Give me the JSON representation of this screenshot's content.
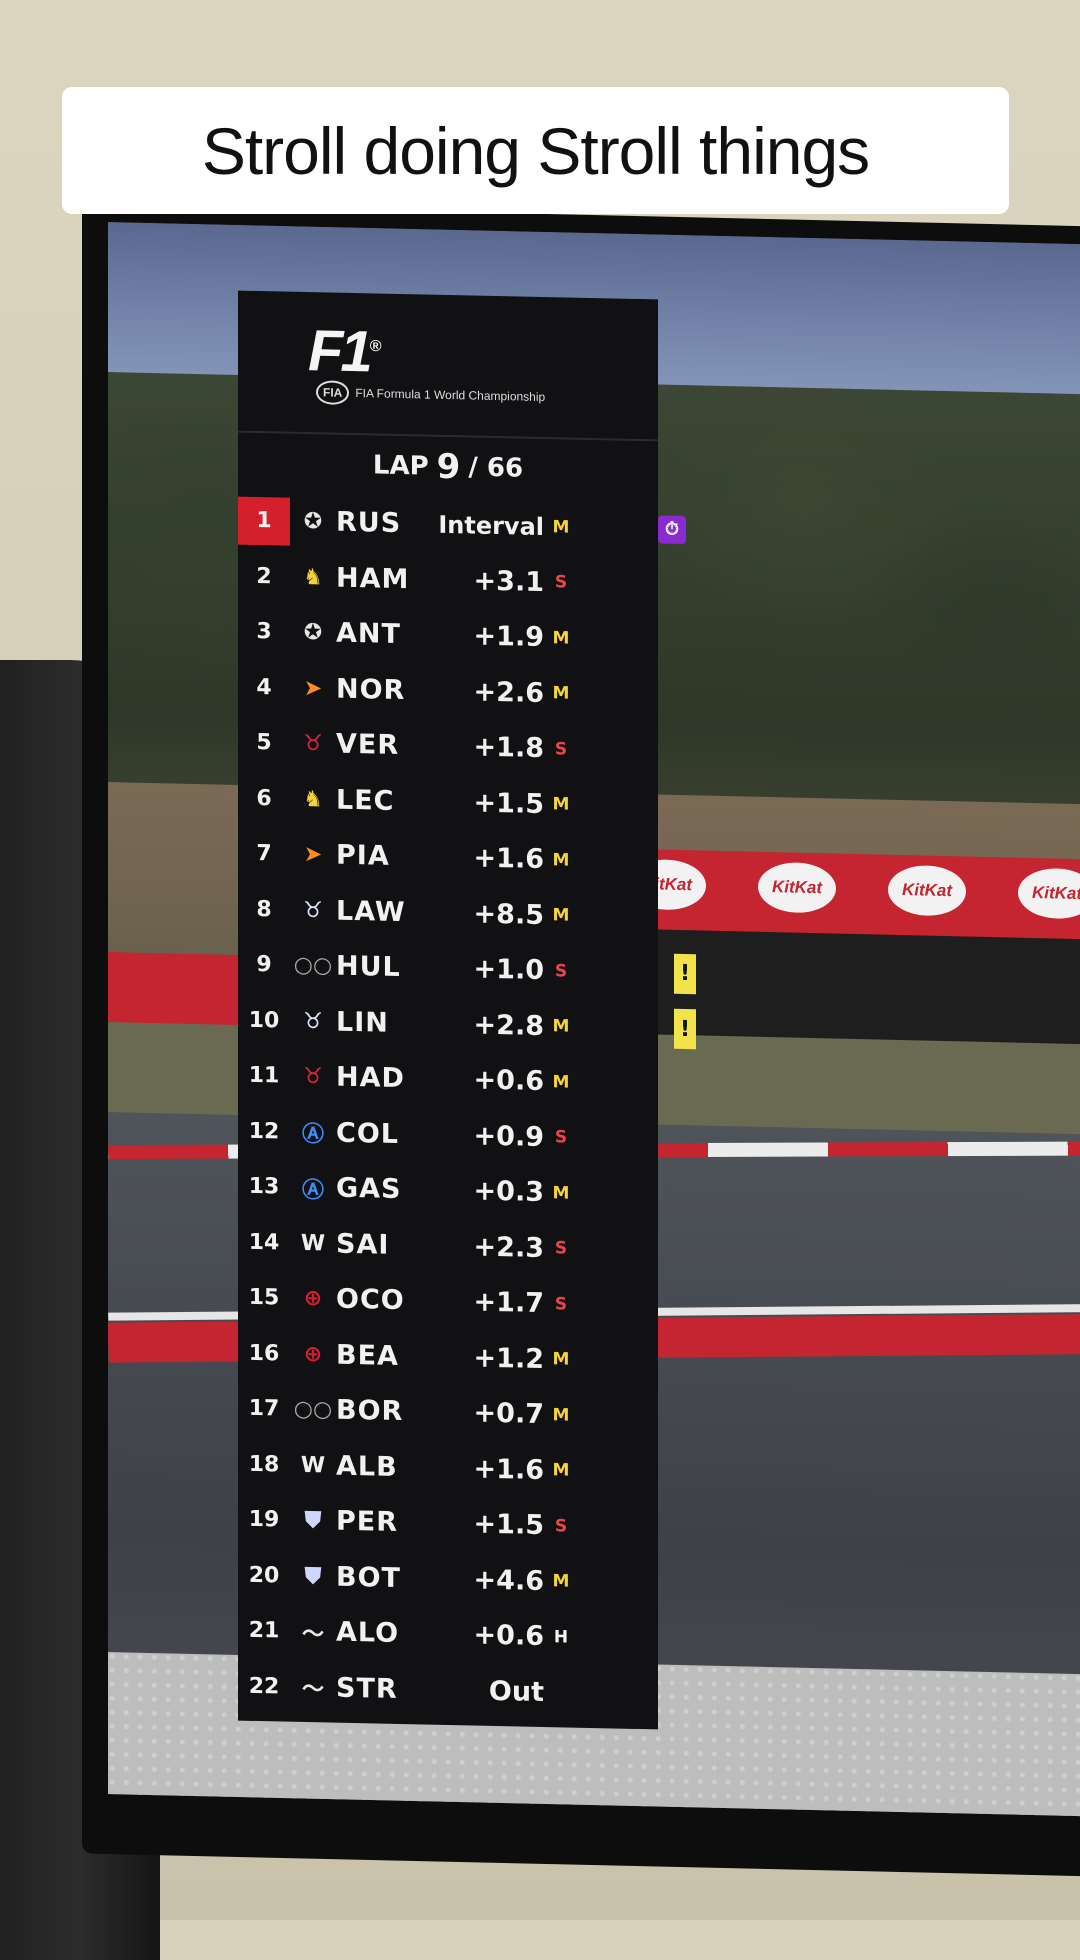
{
  "caption": "Stroll doing Stroll things",
  "broadcast": {
    "brand": "F1",
    "fia_text": "FIA Formula 1 World Championship",
    "lap_label": "LAP",
    "lap_current": "9",
    "lap_total": "/ 66",
    "sponsor": "KitKat"
  },
  "standings": [
    {
      "pos": "1",
      "team_icon": "mercedes-star",
      "code": "RUS",
      "gap": "Interval",
      "tyre": "M",
      "fastest": true
    },
    {
      "pos": "2",
      "team_icon": "ferrari-horse",
      "code": "HAM",
      "gap": "+3.1",
      "tyre": "S"
    },
    {
      "pos": "3",
      "team_icon": "mercedes-star",
      "code": "ANT",
      "gap": "+1.9",
      "tyre": "M"
    },
    {
      "pos": "4",
      "team_icon": "mclaren-swoosh",
      "code": "NOR",
      "gap": "+2.6",
      "tyre": "M"
    },
    {
      "pos": "5",
      "team_icon": "redbull-bulls",
      "code": "VER",
      "gap": "+1.8",
      "tyre": "S"
    },
    {
      "pos": "6",
      "team_icon": "ferrari-horse",
      "code": "LEC",
      "gap": "+1.5",
      "tyre": "M"
    },
    {
      "pos": "7",
      "team_icon": "mclaren-swoosh",
      "code": "PIA",
      "gap": "+1.6",
      "tyre": "M"
    },
    {
      "pos": "8",
      "team_icon": "racing-bulls",
      "code": "LAW",
      "gap": "+8.5",
      "tyre": "M"
    },
    {
      "pos": "9",
      "team_icon": "audi-rings",
      "code": "HUL",
      "gap": "+1.0",
      "tyre": "S",
      "warning": true
    },
    {
      "pos": "10",
      "team_icon": "racing-bulls",
      "code": "LIN",
      "gap": "+2.8",
      "tyre": "M",
      "warning": true
    },
    {
      "pos": "11",
      "team_icon": "redbull-bulls",
      "code": "HAD",
      "gap": "+0.6",
      "tyre": "M"
    },
    {
      "pos": "12",
      "team_icon": "alpine-a",
      "code": "COL",
      "gap": "+0.9",
      "tyre": "S"
    },
    {
      "pos": "13",
      "team_icon": "alpine-a",
      "code": "GAS",
      "gap": "+0.3",
      "tyre": "M"
    },
    {
      "pos": "14",
      "team_icon": "williams-w",
      "code": "SAI",
      "gap": "+2.3",
      "tyre": "S"
    },
    {
      "pos": "15",
      "team_icon": "haas-h",
      "code": "OCO",
      "gap": "+1.7",
      "tyre": "S"
    },
    {
      "pos": "16",
      "team_icon": "haas-h",
      "code": "BEA",
      "gap": "+1.2",
      "tyre": "M"
    },
    {
      "pos": "17",
      "team_icon": "audi-rings",
      "code": "BOR",
      "gap": "+0.7",
      "tyre": "M"
    },
    {
      "pos": "18",
      "team_icon": "williams-w",
      "code": "ALB",
      "gap": "+1.6",
      "tyre": "M"
    },
    {
      "pos": "19",
      "team_icon": "cadillac-crest",
      "code": "PER",
      "gap": "+1.5",
      "tyre": "S"
    },
    {
      "pos": "20",
      "team_icon": "cadillac-crest",
      "code": "BOT",
      "gap": "+4.6",
      "tyre": "M"
    },
    {
      "pos": "21",
      "team_icon": "aston-wings",
      "code": "ALO",
      "gap": "+0.6",
      "tyre": "H"
    },
    {
      "pos": "22",
      "team_icon": "aston-wings",
      "code": "STR",
      "gap": "Out",
      "tyre": ""
    }
  ],
  "colors": {
    "tower_bg": "#111114",
    "leader_red": "#d3202b",
    "fastest_purple": "#8a2bd2",
    "tyre_medium": "#f5d33a",
    "tyre_soft": "#e8454f",
    "tyre_hard": "#f3f3f3",
    "warning_yellow": "#f2e34a"
  }
}
